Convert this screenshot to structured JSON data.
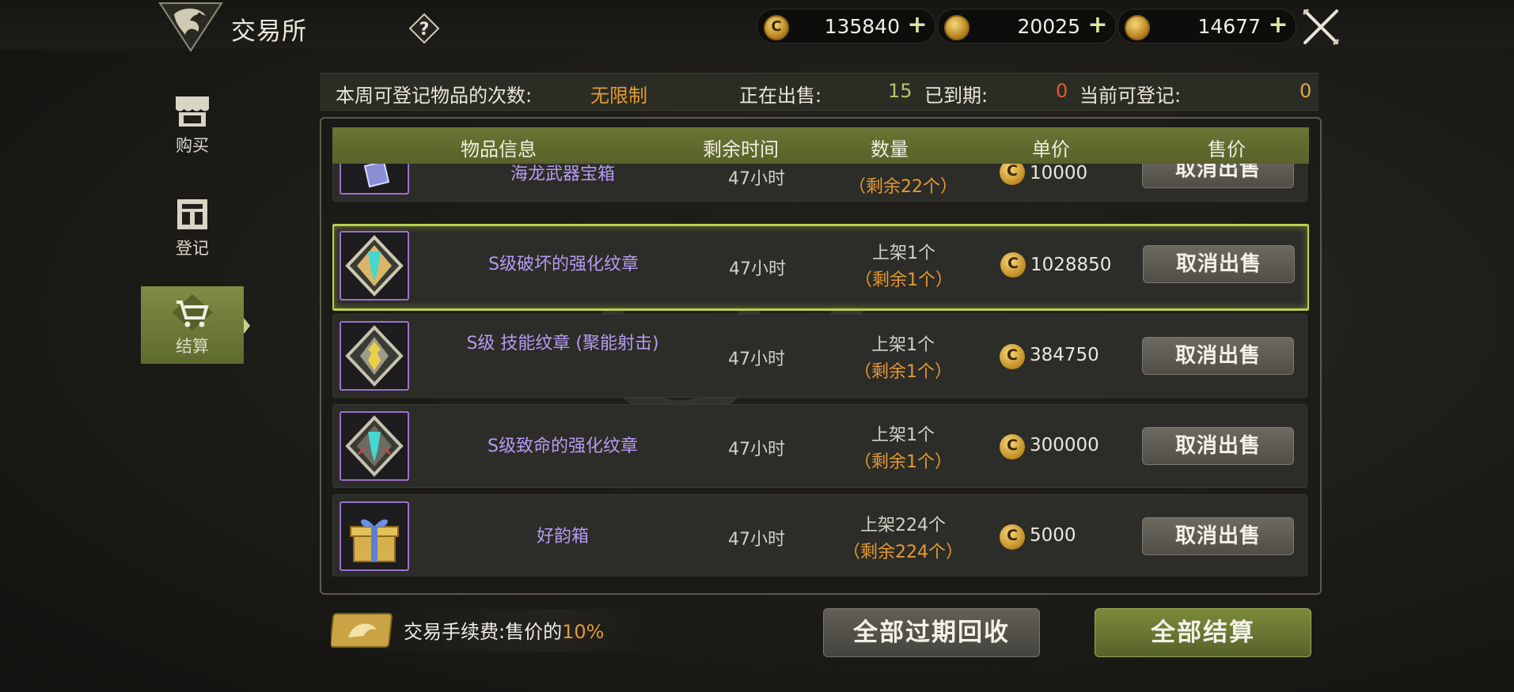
{
  "header": {
    "title": "交易所",
    "help_icon": "question-icon",
    "currencies": [
      {
        "icon": "c-coin-icon",
        "value": "135840",
        "plus": "+"
      },
      {
        "icon": "gold-coin-stack-icon",
        "value": "20025",
        "plus": "+"
      },
      {
        "icon": "gold-coin-icon",
        "value": "14677",
        "plus": "+"
      }
    ],
    "close_icon": "crossed-swords-close-icon"
  },
  "sidebar": {
    "items": [
      {
        "label": "购买",
        "icon": "shop-icon",
        "active": false
      },
      {
        "label": "登记",
        "icon": "register-icon",
        "active": false
      },
      {
        "label": "结算",
        "icon": "cart-icon",
        "active": true
      }
    ]
  },
  "stats": {
    "weekly_label": "本周可登记物品的次数:",
    "weekly_value": "无限制",
    "selling_label": "正在出售:",
    "selling_value": "15",
    "expired_label": "已到期:",
    "expired_value": "0",
    "available_label": "当前可登记:",
    "available_value": "0"
  },
  "table": {
    "columns": [
      "物品信息",
      "剩余时间",
      "数量",
      "单价",
      "售价"
    ],
    "partial_row": {
      "name": "海龙武器宝箱",
      "time": "47小时",
      "qty_remaining": "（剩余22个）",
      "price": "10000",
      "action": "取消出售"
    },
    "rows": [
      {
        "name": "S级破坏的强化纹章",
        "icon": "destruction-emblem-icon",
        "time": "47小时",
        "qty_listed": "上架1个",
        "qty_remaining": "（剩余1个）",
        "price": "1028850",
        "action": "取消出售",
        "selected": true
      },
      {
        "name": "S级 技能纹章 (聚能射击)",
        "icon": "skill-emblem-icon",
        "time": "47小时",
        "qty_listed": "上架1个",
        "qty_remaining": "（剩余1个）",
        "price": "384750",
        "action": "取消出售",
        "selected": false
      },
      {
        "name": "S级致命的强化纹章",
        "icon": "lethal-emblem-icon",
        "time": "47小时",
        "qty_listed": "上架1个",
        "qty_remaining": "（剩余1个）",
        "price": "300000",
        "action": "取消出售",
        "selected": false
      },
      {
        "name": "好韵箱",
        "icon": "gift-box-icon",
        "time": "47小时",
        "qty_listed": "上架224个",
        "qty_remaining": "（剩余224个）",
        "price": "5000",
        "action": "取消出售",
        "selected": false
      }
    ]
  },
  "footer": {
    "fee_label": "交易手续费:售价的",
    "fee_percent": "10%",
    "recycle_button": "全部过期回收",
    "settle_button": "全部结算"
  },
  "colors": {
    "accent_green": "#6a7434",
    "selected_border": "#b9d04a",
    "orange": "#e49a33",
    "purple_name": "#b69bf0"
  }
}
